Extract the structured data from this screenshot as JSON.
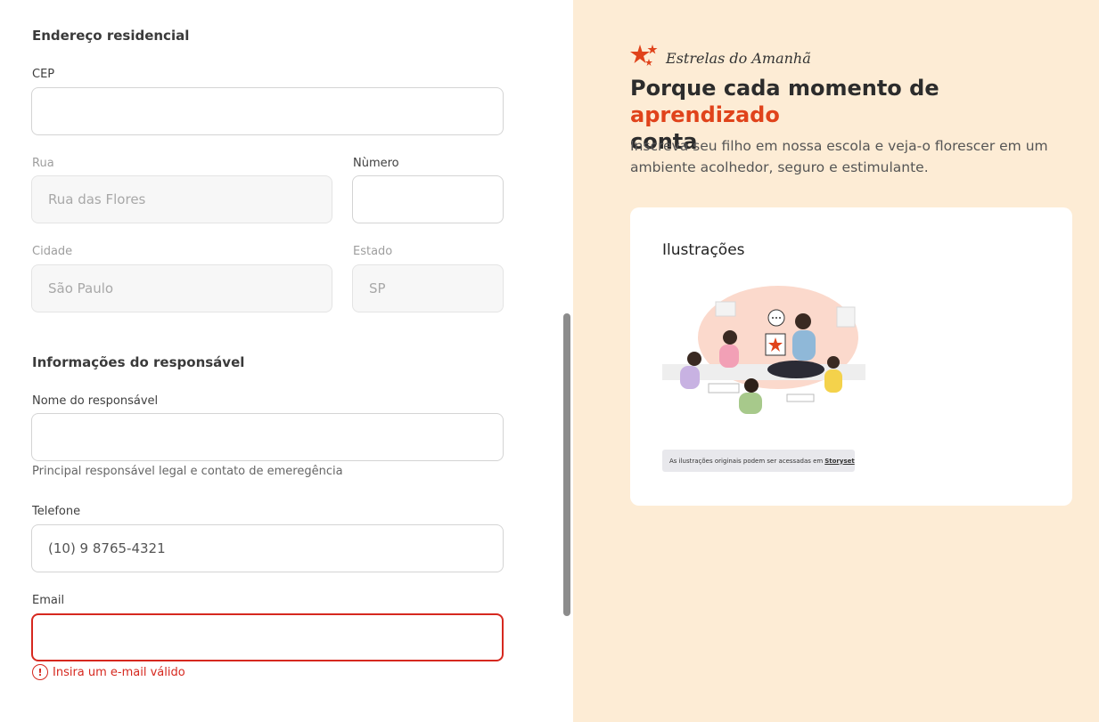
{
  "address": {
    "section_title": "Endereço residencial",
    "cep": {
      "label": "CEP",
      "value": ""
    },
    "street": {
      "label": "Rua",
      "value": "Rua das Flores"
    },
    "number": {
      "label": "Nùmero",
      "value": ""
    },
    "city": {
      "label": "Cidade",
      "value": "São Paulo"
    },
    "state": {
      "label": "Estado",
      "value": "SP"
    }
  },
  "guardian": {
    "section_title": "Informações do responsável",
    "name": {
      "label": "Nome do responsável",
      "value": "",
      "helper": "Principal responsável legal e contato de emeregência"
    },
    "phone": {
      "label": "Telefone",
      "value": "(10) 9 8765-4321"
    },
    "email": {
      "label": "Email",
      "value": "",
      "error": "Insira um e-mail válido",
      "error_icon": "!"
    }
  },
  "promo": {
    "brand": "Estrelas do Amanhã",
    "headline_part1": "Porque cada momento de ",
    "headline_accent": "aprendizado",
    "headline_part2": "conta",
    "subtitle": "Inscreva seu filho em nossa escola e veja-o florescer em um ambiente acolhedor, seguro e estimulante.",
    "card_title": "Ilustrações",
    "credit_text": "As ilustrações originais podem ser acessadas em",
    "credit_link": "Storyset",
    "accent_color": "#e0431b",
    "background_color": "#fdecd5"
  },
  "colors": {
    "error": "#d6281f"
  }
}
